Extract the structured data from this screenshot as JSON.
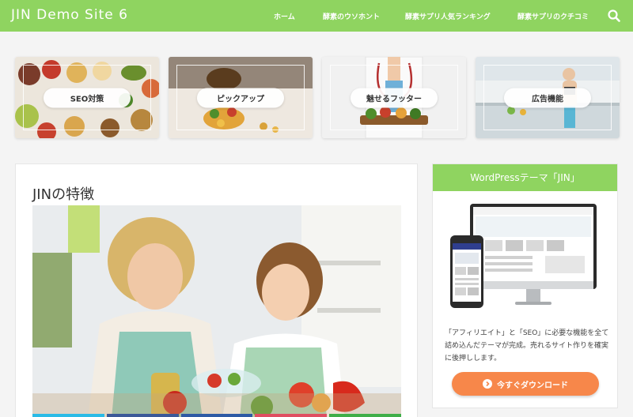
{
  "header": {
    "site_title": "JIN Demo Site 6",
    "nav": [
      "ホーム",
      "酵素のウソホント",
      "酵素サプリ人気ランキング",
      "酵素サプリのクチコミ"
    ],
    "search_icon": "search-icon"
  },
  "pickup": [
    {
      "label": "SEO対策",
      "image": "healthy-food-bowls-photo"
    },
    {
      "label": "ピックアップ",
      "image": "supplement-capsules-vegetables-photo"
    },
    {
      "label": "魅せるフッター",
      "image": "doctor-holding-vegetables-photo"
    },
    {
      "label": "広告機能",
      "image": "woman-drinking-in-kitchen-photo"
    }
  ],
  "article": {
    "title": "JINの特徴",
    "hero_image": "mother-and-daughter-cooking-photo"
  },
  "sidebar": {
    "widget_title": "WordPressテーマ「JIN」",
    "widget_image": "jin-theme-devices-mockup",
    "text": "「アフィリエイト」と「SEO」に必要な機能を全て詰め込んだテーマが完成。売れるサイト作りを確実に後押しします。",
    "button_label": "今すぐダウンロード",
    "button_icon": "chevron-circle-icon"
  },
  "colors": {
    "header": "#8fd460",
    "accent_button": "#f7874a",
    "background": "#f4f4f4"
  }
}
